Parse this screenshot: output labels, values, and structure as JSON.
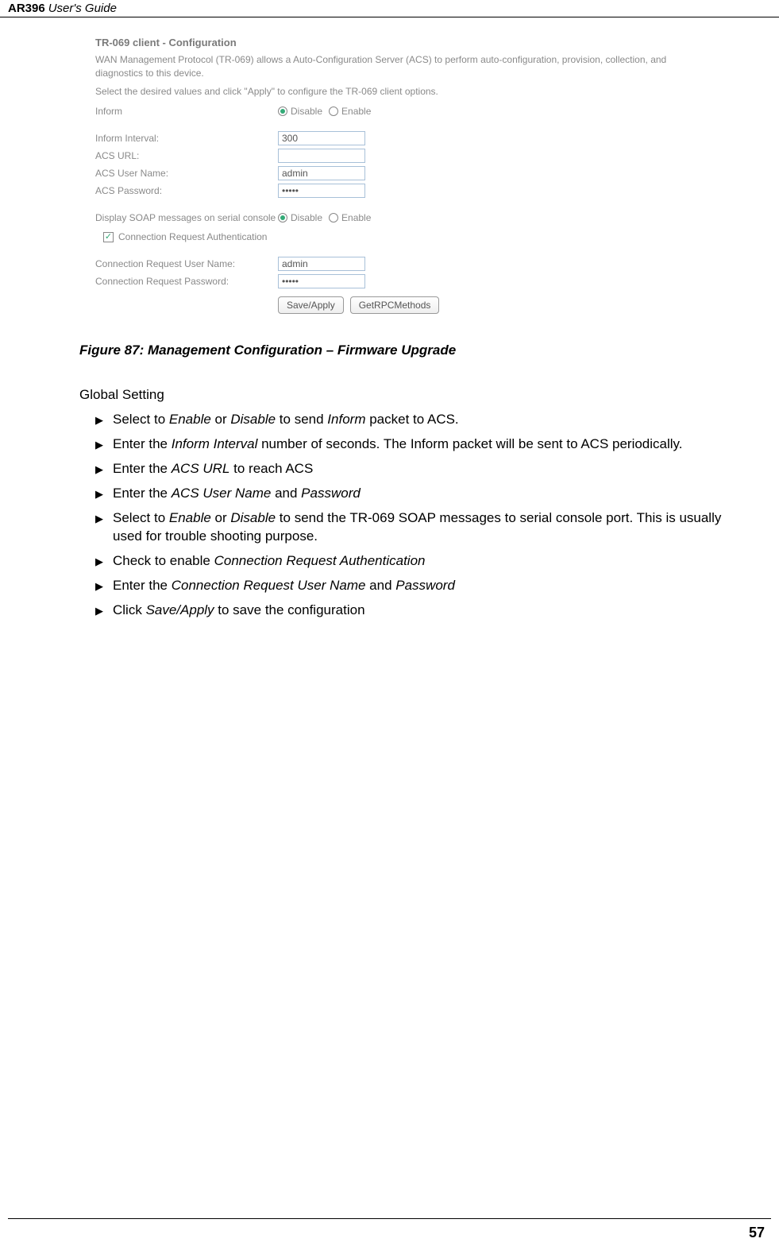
{
  "header": {
    "bold": "AR396",
    "italic": "User's Guide"
  },
  "screenshot": {
    "title": "TR-069 client - Configuration",
    "desc1": "WAN Management Protocol (TR-069) allows a Auto-Configuration Server (ACS) to perform auto-configuration, provision, collection, and diagnostics to this device.",
    "desc2": "Select the desired values and click \"Apply\" to configure the TR-069 client options.",
    "rows": {
      "inform_label": "Inform",
      "disable": "Disable",
      "enable": "Enable",
      "inform_interval_label": "Inform Interval:",
      "inform_interval_value": "300",
      "acs_url_label": "ACS URL:",
      "acs_url_value": "",
      "acs_user_label": "ACS User Name:",
      "acs_user_value": "admin",
      "acs_pass_label": "ACS Password:",
      "acs_pass_value": "•••••",
      "soap_label": "Display SOAP messages on serial console",
      "conn_auth_label": "Connection Request Authentication",
      "conn_user_label": "Connection Request User Name:",
      "conn_user_value": "admin",
      "conn_pass_label": "Connection Request Password:",
      "conn_pass_value": "•••••"
    },
    "buttons": {
      "save": "Save/Apply",
      "rpc": "GetRPCMethods"
    }
  },
  "figure_caption": "Figure 87: Management Configuration – Firmware Upgrade",
  "section_title": "Global Setting",
  "bullets": [
    {
      "pre": "Select to ",
      "i1": "Enable",
      "m1": " or ",
      "i2": "Disable",
      "m2": " to send ",
      "i3": "Inform",
      "post": " packet to ACS."
    },
    {
      "pre": "Enter the ",
      "i1": "Inform Interval",
      "post": " number of seconds. The Inform packet will be sent to ACS periodically."
    },
    {
      "pre": "Enter the ",
      "i1": "ACS URL",
      "post": " to reach ACS"
    },
    {
      "pre": "Enter the ",
      "i1": "ACS User Name",
      "m1": " and ",
      "i2": "Password",
      "post": ""
    },
    {
      "pre": "Select to ",
      "i1": "Enable",
      "m1": " or ",
      "i2": "Disable",
      "post": " to send the TR-069 SOAP messages to serial console port. This is usually used for trouble shooting purpose."
    },
    {
      "pre": "Check to enable ",
      "i1": "Connection Request Authentication",
      "post": ""
    },
    {
      "pre": "Enter the ",
      "i1": "Connection Request User Name",
      "m1": " and ",
      "i2": "Password",
      "post": ""
    },
    {
      "pre": "Click ",
      "i1": "Save/Apply",
      "post": " to save the configuration"
    }
  ],
  "page_number": "57"
}
